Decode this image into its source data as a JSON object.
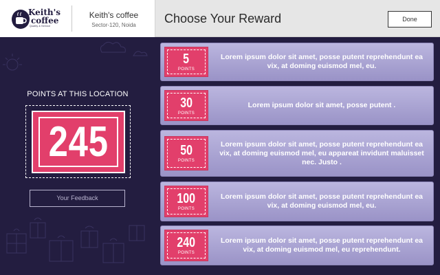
{
  "brand": {
    "logo_line1": "Keith's",
    "logo_line2": "coffee",
    "logo_tagline": "Quality & Service",
    "store_name": "Keith's coffee",
    "store_location": "Sector-120, Noida"
  },
  "header": {
    "title": "Choose Your Reward",
    "done_label": "Done"
  },
  "points": {
    "title": "POINTS AT THIS LOCATION",
    "value": "245"
  },
  "feedback": {
    "label": "Your Feedback"
  },
  "rewards": [
    {
      "points": "5",
      "unit": "POINTS",
      "description": "Lorem ipsum dolor sit amet, posse putent reprehendunt ea vix, at doming euismod mel, eu."
    },
    {
      "points": "30",
      "unit": "POINTS",
      "description": "Lorem ipsum dolor sit amet, posse putent ."
    },
    {
      "points": "50",
      "unit": "POINTS",
      "description": "Lorem ipsum dolor sit amet, posse putent reprehendunt ea vix, at doming euismod mel, eu appareat invidunt maluisset nec. Justo ."
    },
    {
      "points": "100",
      "unit": "POINTS",
      "description": "Lorem ipsum dolor sit amet, posse putent reprehendunt ea vix, at doming euismod mel, eu."
    },
    {
      "points": "240",
      "unit": "POINTS",
      "description": "Lorem ipsum dolor sit amet, posse putent reprehendunt ea vix, at doming euismod mel, eu reprehendunt."
    }
  ],
  "colors": {
    "background": "#231d40",
    "accent": "#e23f6b",
    "card": "#ada7d6",
    "header": "#e6e6e6"
  },
  "icons": [
    "coffee-cup-icon"
  ]
}
